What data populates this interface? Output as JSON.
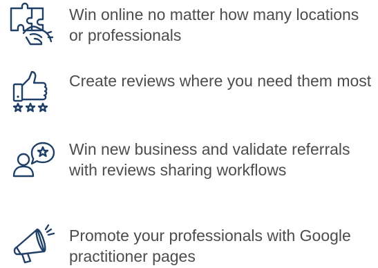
{
  "features": [
    {
      "icon": "puzzle-hand-icon",
      "text": "Win online no matter how many locations or professionals"
    },
    {
      "icon": "thumbs-up-stars-icon",
      "text": "Create reviews where you need them most"
    },
    {
      "icon": "person-star-bubble-icon",
      "text": "Win new business and validate referrals with reviews sharing workflows"
    },
    {
      "icon": "megaphone-icon",
      "text": "Promote your professionals with Google practitioner pages"
    }
  ],
  "colors": {
    "icon_stroke": "#1f3f66",
    "text": "#4c4c4c",
    "background": "#ffffff"
  }
}
